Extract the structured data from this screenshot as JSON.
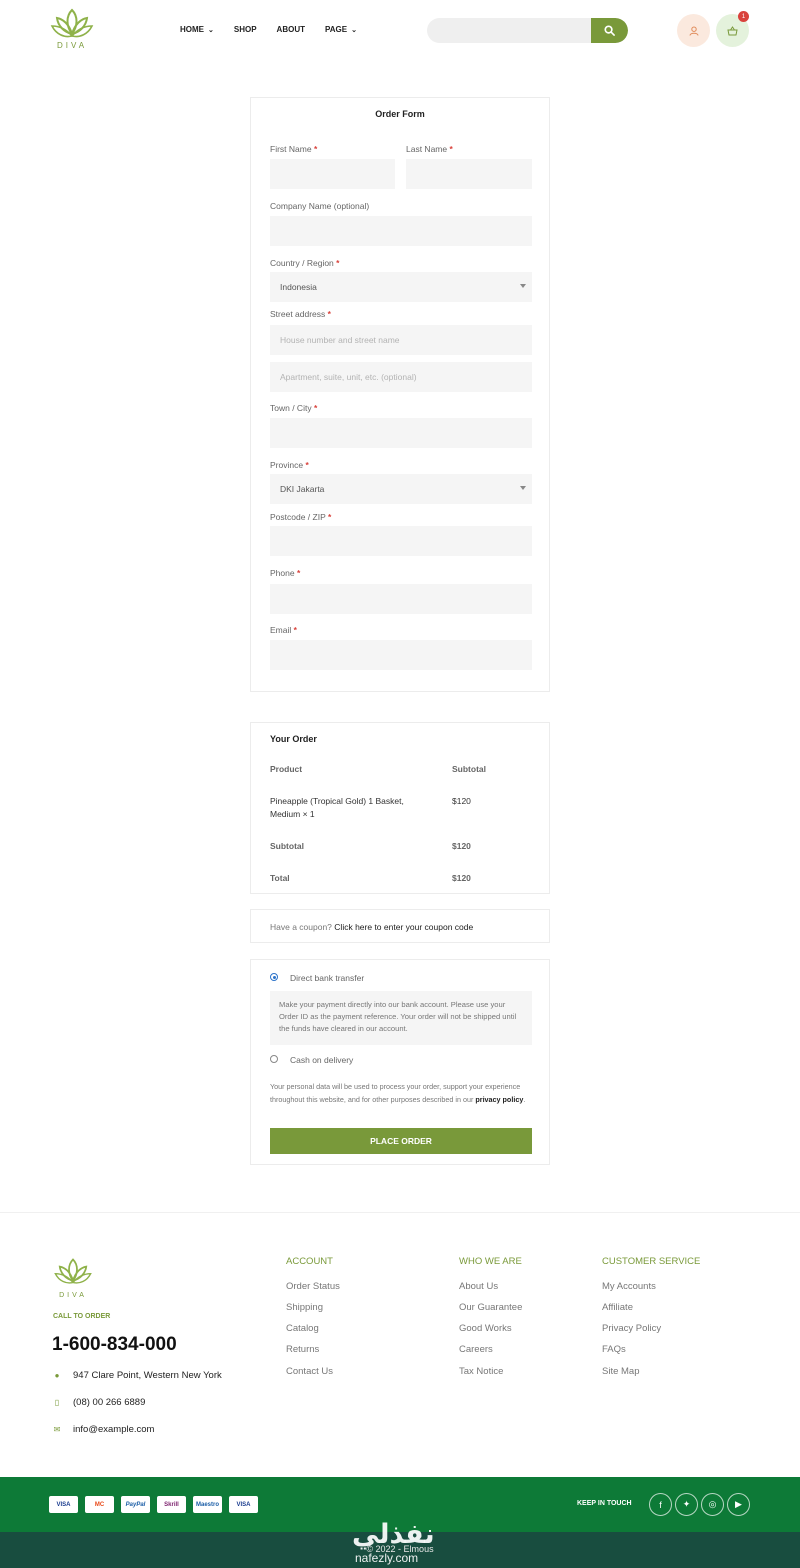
{
  "brand": {
    "name": "DIVA"
  },
  "nav": {
    "items": [
      {
        "label": "HOME",
        "has_dropdown": true
      },
      {
        "label": "SHOP",
        "has_dropdown": false
      },
      {
        "label": "ABOUT",
        "has_dropdown": false
      },
      {
        "label": "PAGE",
        "has_dropdown": true
      }
    ]
  },
  "header": {
    "cart_count": "1"
  },
  "order_form": {
    "title": "Order Form",
    "fields": {
      "first_name": {
        "label": "First Name",
        "value": ""
      },
      "last_name": {
        "label": "Last Name",
        "value": ""
      },
      "company": {
        "label": "Company Name (optional)",
        "value": ""
      },
      "country": {
        "label": "Country / Region",
        "value": "Indonesia"
      },
      "street": {
        "label": "Street address",
        "placeholder1": "House number and street name",
        "placeholder2": "Apartment, suite, unit, etc. (optional)"
      },
      "town": {
        "label": "Town / City",
        "value": ""
      },
      "province": {
        "label": "Province",
        "value": "DKI Jakarta"
      },
      "postcode": {
        "label": "Postcode / ZIP",
        "value": ""
      },
      "phone": {
        "label": "Phone",
        "value": ""
      },
      "email": {
        "label": "Email",
        "value": ""
      }
    },
    "required_mark": "*"
  },
  "your_order": {
    "title": "Your Order",
    "col_product": "Product",
    "col_subtotal": "Subtotal",
    "item_name_line1": "Pineapple (Tropical Gold) 1 Basket,",
    "item_name_line2": "Medium  × 1",
    "item_price": "$120",
    "subtotal_label": "Subtotal",
    "subtotal_value": "$120",
    "total_label": "Total",
    "total_value": "$120"
  },
  "coupon": {
    "prompt": "Have a coupon?",
    "link": "Click here to enter your coupon code"
  },
  "payment": {
    "option1": "Direct bank transfer",
    "option1_desc": "Make your payment directly into our bank account. Please use your Order ID as the payment reference. Your order will not be shipped until the funds have cleared in our account.",
    "option2": "Cash on delivery",
    "privacy_text": "Your personal data will be used to process your order, support your experience throughout this website, and for other purposes described in our",
    "privacy_link": "privacy policy",
    "privacy_end": ".",
    "button": "PLACE ORDER"
  },
  "footer": {
    "call_label": "CALL TO ORDER",
    "phone_big": "1-600-834-000",
    "address": "947 Clare Point, Western New York",
    "phone": "(08) 00 266 6889",
    "email": "info@example.com",
    "columns": [
      {
        "title": "ACCOUNT",
        "links": [
          "Order Status",
          "Shipping",
          "Catalog",
          "Returns",
          "Contact Us"
        ]
      },
      {
        "title": "WHO WE ARE",
        "links": [
          "About Us",
          "Our Guarantee",
          "Good Works",
          "Careers",
          "Tax Notice"
        ]
      },
      {
        "title": "CUSTOMER SERVICE",
        "links": [
          "My Accounts",
          "Affiliate",
          "Privacy Policy",
          "FAQs",
          "Site Map"
        ]
      }
    ],
    "payment_cards": [
      "VISA",
      "MC",
      "PayPal",
      "Skrill",
      "Maestro",
      "VISA"
    ],
    "keep_in_touch": "KEEP IN TOUCH",
    "copyright": "© 2022 - Elmous",
    "watermark": "نفذلي",
    "watermark_url": "nafezly.com"
  },
  "colors": {
    "accent": "#79993a",
    "footer_green": "#0d7a37",
    "footer_dark": "#184d3f",
    "required": "#d9423c"
  }
}
